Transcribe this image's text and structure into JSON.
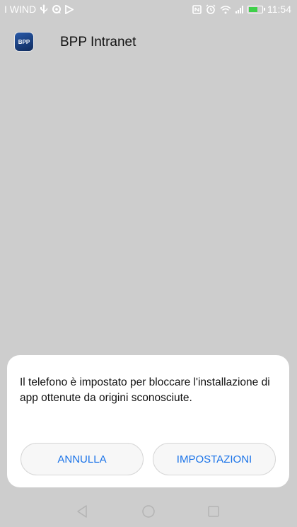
{
  "status_bar": {
    "carrier": "I WIND",
    "time": "11:54",
    "battery_level": 0.6
  },
  "app": {
    "title": "BPP Intranet",
    "logo_text": "BPP"
  },
  "dialog": {
    "message": "Il telefono è impostato per bloccare l'installazione di app ottenute da origini sconosciute.",
    "cancel_label": "ANNULLA",
    "settings_label": "IMPOSTAZIONI"
  },
  "colors": {
    "background": "#cdcdcd",
    "accent": "#1a73e8",
    "dialog": "#ffffff"
  },
  "icons": {
    "usb": "usb-icon",
    "sync": "sync-icon",
    "play_store": "play-store-icon",
    "nfc": "nfc-icon",
    "alarm": "alarm-icon",
    "wifi": "wifi-icon",
    "signal": "signal-icon",
    "battery": "battery-icon",
    "back": "back-icon",
    "home": "home-icon",
    "recent": "recent-apps-icon"
  }
}
